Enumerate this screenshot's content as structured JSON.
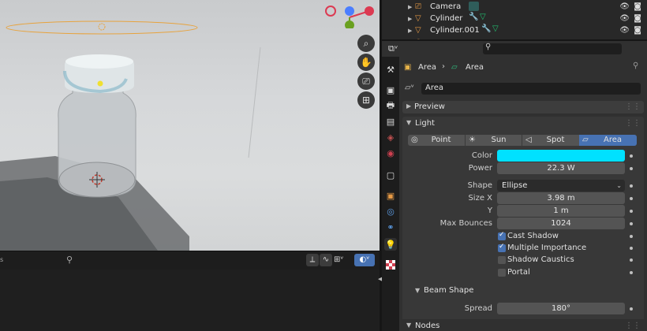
{
  "outliner": {
    "items": [
      {
        "name": "Camera",
        "icon": "camera-icon"
      },
      {
        "name": "Cylinder",
        "icon": "mesh-icon"
      },
      {
        "name": "Cylinder.001",
        "icon": "mesh-icon"
      }
    ]
  },
  "properties": {
    "breadcrumb": [
      "Area",
      "Area"
    ],
    "datablock_name": "Area",
    "preview_label": "Preview",
    "light_label": "Light",
    "light_types": [
      "Point",
      "Sun",
      "Spot",
      "Area"
    ],
    "active_light_type": "Area",
    "color_label": "Color",
    "color_value": "#00e1ff",
    "power_label": "Power",
    "power_value": "22.3 W",
    "shape_label": "Shape",
    "shape_value": "Ellipse",
    "sizex_label": "Size X",
    "sizex_value": "3.98 m",
    "y_label": "Y",
    "y_value": "1 m",
    "bounces_label": "Max Bounces",
    "bounces_value": "1024",
    "cast_shadow": "Cast Shadow",
    "multiple_importance": "Multiple Importance",
    "shadow_caustics": "Shadow Caustics",
    "portal": "Portal",
    "beam_shape_label": "Beam Shape",
    "spread_label": "Spread",
    "spread_value": "180°",
    "nodes_label": "Nodes"
  },
  "colors": {
    "accent": "#4772b3",
    "light_color": "#00e1ff",
    "selection_orange": "#e7a33e"
  }
}
